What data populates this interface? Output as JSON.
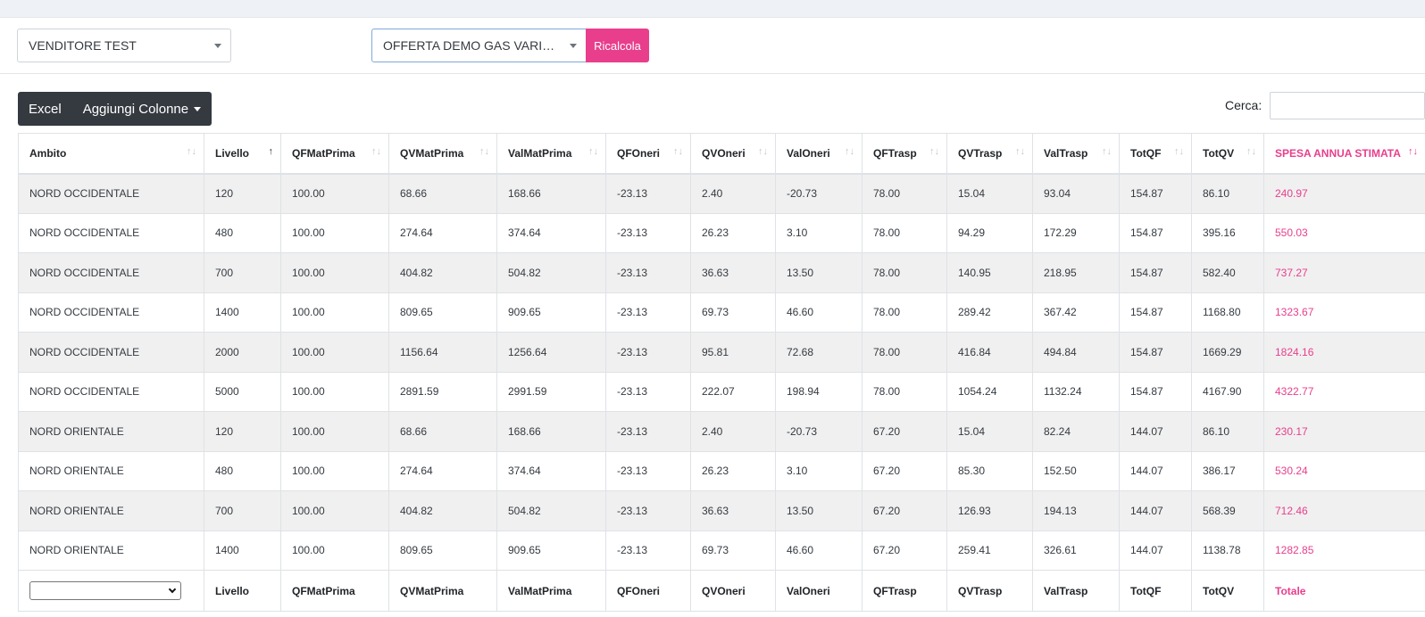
{
  "filters": {
    "venditore": "VENDITORE TEST",
    "offerta": "OFFERTA DEMO GAS VARIA…",
    "ricalcola_label": "Ricalcola"
  },
  "toolbar": {
    "excel_label": "Excel",
    "add_columns_label": "Aggiungi Colonne"
  },
  "search": {
    "label": "Cerca:",
    "value": ""
  },
  "table": {
    "headers": [
      "Ambito",
      "Livello",
      "QFMatPrima",
      "QVMatPrima",
      "ValMatPrima",
      "QFOneri",
      "QVOneri",
      "ValOneri",
      "QFTrasp",
      "QVTrasp",
      "ValTrasp",
      "TotQF",
      "TotQV",
      "SPESA ANNUA STIMATA"
    ],
    "sorted_column": "Livello",
    "sort_direction": "asc",
    "accent_color": "#e83e8c",
    "rows": [
      [
        "NORD OCCIDENTALE",
        "120",
        "100.00",
        "68.66",
        "168.66",
        "-23.13",
        "2.40",
        "-20.73",
        "78.00",
        "15.04",
        "93.04",
        "154.87",
        "86.10",
        "240.97"
      ],
      [
        "NORD OCCIDENTALE",
        "480",
        "100.00",
        "274.64",
        "374.64",
        "-23.13",
        "26.23",
        "3.10",
        "78.00",
        "94.29",
        "172.29",
        "154.87",
        "395.16",
        "550.03"
      ],
      [
        "NORD OCCIDENTALE",
        "700",
        "100.00",
        "404.82",
        "504.82",
        "-23.13",
        "36.63",
        "13.50",
        "78.00",
        "140.95",
        "218.95",
        "154.87",
        "582.40",
        "737.27"
      ],
      [
        "NORD OCCIDENTALE",
        "1400",
        "100.00",
        "809.65",
        "909.65",
        "-23.13",
        "69.73",
        "46.60",
        "78.00",
        "289.42",
        "367.42",
        "154.87",
        "1168.80",
        "1323.67"
      ],
      [
        "NORD OCCIDENTALE",
        "2000",
        "100.00",
        "1156.64",
        "1256.64",
        "-23.13",
        "95.81",
        "72.68",
        "78.00",
        "416.84",
        "494.84",
        "154.87",
        "1669.29",
        "1824.16"
      ],
      [
        "NORD OCCIDENTALE",
        "5000",
        "100.00",
        "2891.59",
        "2991.59",
        "-23.13",
        "222.07",
        "198.94",
        "78.00",
        "1054.24",
        "1132.24",
        "154.87",
        "4167.90",
        "4322.77"
      ],
      [
        "NORD ORIENTALE",
        "120",
        "100.00",
        "68.66",
        "168.66",
        "-23.13",
        "2.40",
        "-20.73",
        "67.20",
        "15.04",
        "82.24",
        "144.07",
        "86.10",
        "230.17"
      ],
      [
        "NORD ORIENTALE",
        "480",
        "100.00",
        "274.64",
        "374.64",
        "-23.13",
        "26.23",
        "3.10",
        "67.20",
        "85.30",
        "152.50",
        "144.07",
        "386.17",
        "530.24"
      ],
      [
        "NORD ORIENTALE",
        "700",
        "100.00",
        "404.82",
        "504.82",
        "-23.13",
        "36.63",
        "13.50",
        "67.20",
        "126.93",
        "194.13",
        "144.07",
        "568.39",
        "712.46"
      ],
      [
        "NORD ORIENTALE",
        "1400",
        "100.00",
        "809.65",
        "909.65",
        "-23.13",
        "69.73",
        "46.60",
        "67.20",
        "259.41",
        "326.61",
        "144.07",
        "1138.78",
        "1282.85"
      ]
    ],
    "footer": [
      "",
      "Livello",
      "QFMatPrima",
      "QVMatPrima",
      "ValMatPrima",
      "QFOneri",
      "QVOneri",
      "ValOneri",
      "QFTrasp",
      "QVTrasp",
      "ValTrasp",
      "TotQF",
      "TotQV",
      "Totale"
    ],
    "footer_select_value": ""
  },
  "icons": {
    "sort_neutral": "sort-icon",
    "sort_asc": "sort-asc-icon",
    "dropdown": "chevron-down-icon"
  }
}
